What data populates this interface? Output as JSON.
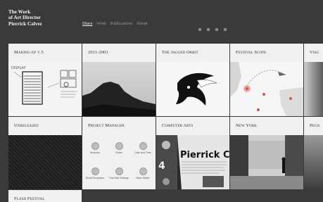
{
  "site": {
    "title_lines": [
      "The Work",
      "of Art Director",
      "Pierrick Calvez"
    ]
  },
  "nav": {
    "items": [
      {
        "label": "Diary",
        "active": true
      },
      {
        "label": "Work",
        "active": false
      },
      {
        "label": "Publications",
        "active": false
      },
      {
        "label": "About",
        "active": false
      }
    ]
  },
  "social_icons": [
    "twitter-icon",
    "email-icon",
    "link-icon",
    "rss-icon"
  ],
  "tiles": [
    {
      "title": "Making-of v.5"
    },
    {
      "title": "2011-2001"
    },
    {
      "title": "The Jagged Orbit"
    },
    {
      "title": "Festival Scope"
    },
    {
      "title": "Visu"
    },
    {
      "title": "Unreleased"
    },
    {
      "title": "Project Manager"
    },
    {
      "title": "Computer Arts"
    },
    {
      "title": "New York"
    },
    {
      "title": "Pech"
    },
    {
      "title": "Flash Festival"
    }
  ],
  "project_manager": {
    "items": [
      "Modules",
      "Roles",
      "Date and Time",
      "Email Templates",
      "Test Mail Settings",
      "Mass Mailer"
    ]
  },
  "thumb_text": {
    "sketch_label": "DISPLAY",
    "magazine_big": "Pierrick Cal",
    "magazine_num": "4"
  },
  "colors": {
    "background": "#3a3a3a",
    "tile": "#f0f0f0",
    "nav_active": "#f2f2f2",
    "nav_inactive": "#9a9a9a",
    "map_marker": "#e88a7a"
  }
}
